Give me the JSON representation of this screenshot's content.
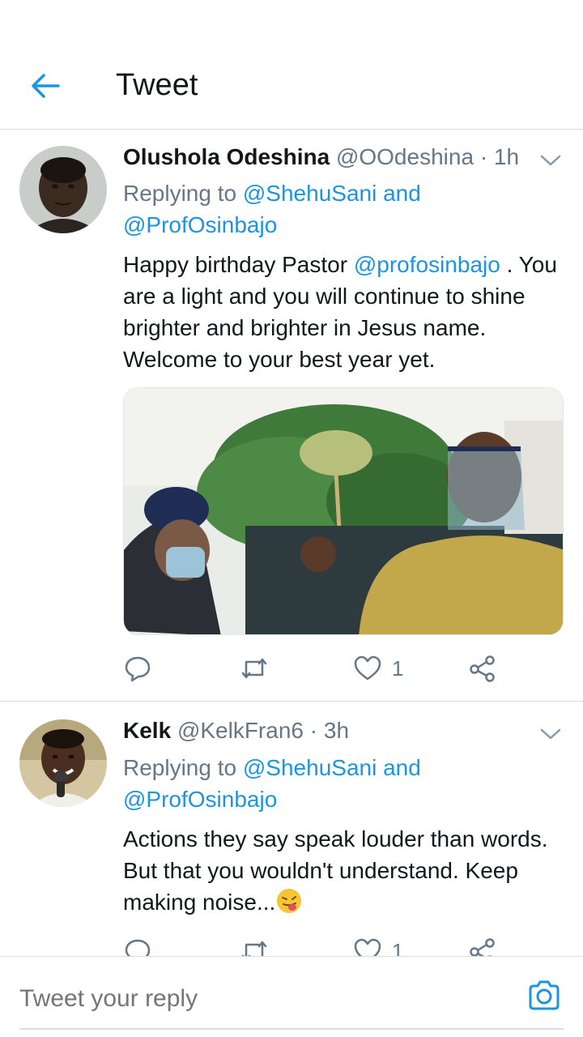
{
  "header": {
    "title": "Tweet"
  },
  "tweets": [
    {
      "name": "Olushola Odeshina",
      "handle": "@OOdeshina",
      "time": "· 1h",
      "reply_prefix": "Replying to",
      "reply_user1": "@ShehuSani",
      "reply_and": "and",
      "reply_user2": "@ProfOsinbajo",
      "text_part1": "Happy birthday Pastor",
      "text_mention": "@profosinbajo",
      "text_part2": ". You are a light and you will continue to shine brighter and brighter in Jesus name. Welcome to your best year yet.",
      "likes": "1"
    },
    {
      "name": "Kelk",
      "handle": "@KelkFran6",
      "time": "· 3h",
      "reply_prefix": "Replying to",
      "reply_user1": "@ShehuSani",
      "reply_and": "and",
      "reply_user2": "@ProfOsinbajo",
      "text": "Actions they say speak louder than words. But that you wouldn't understand. Keep making noise...",
      "likes": "1"
    }
  ],
  "composer": {
    "placeholder": "Tweet your reply"
  },
  "colors": {
    "accent": "#1b95e0",
    "muted": "#657786",
    "text": "#14171a",
    "divider": "#d9dde1"
  },
  "icons": [
    "back-arrow-icon",
    "chevron-down-icon",
    "reply-icon",
    "retweet-icon",
    "like-icon",
    "share-icon",
    "camera-icon",
    "tongue-emoji-icon"
  ]
}
